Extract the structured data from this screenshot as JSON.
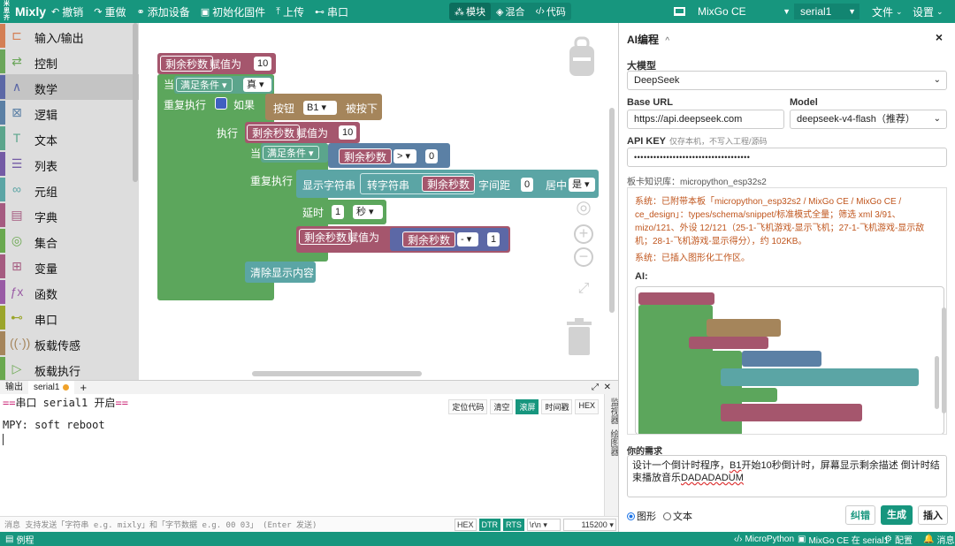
{
  "app": {
    "logo_mark": "米思齐",
    "logo_text": "Mixly"
  },
  "toolbar": {
    "undo": "撤销",
    "redo": "重做",
    "add_device": "添加设备",
    "init_firmware": "初始化固件",
    "upload": "上传",
    "serial": "串口"
  },
  "mode_tabs": [
    {
      "label": "模块",
      "active": true
    },
    {
      "label": "混合",
      "active": false
    },
    {
      "label": "代码",
      "active": false
    }
  ],
  "board": "MixGo CE",
  "port": "serial1",
  "menus": {
    "file": "文件",
    "settings": "设置"
  },
  "categories": [
    {
      "label": "输入/输出",
      "color": "#d47f54",
      "icon": "io-icon",
      "glyph": "⊏"
    },
    {
      "label": "控制",
      "color": "#6ba65a",
      "icon": "control-icon",
      "glyph": "⇄"
    },
    {
      "label": "数学",
      "color": "#5c68a6",
      "icon": "math-icon",
      "glyph": "∧",
      "selected": true
    },
    {
      "label": "逻辑",
      "color": "#5b80a5",
      "icon": "logic-icon",
      "glyph": "⊠"
    },
    {
      "label": "文本",
      "color": "#5ba58c",
      "icon": "text-icon",
      "glyph": "T"
    },
    {
      "label": "列表",
      "color": "#745ba5",
      "icon": "list-icon",
      "glyph": "☰"
    },
    {
      "label": "元组",
      "color": "#5ba5a5",
      "icon": "tuple-icon",
      "glyph": "∞"
    },
    {
      "label": "字典",
      "color": "#a55b80",
      "icon": "dict-icon",
      "glyph": "▤"
    },
    {
      "label": "集合",
      "color": "#6aa84f",
      "icon": "set-icon",
      "glyph": "◎"
    },
    {
      "label": "变量",
      "color": "#a55b80",
      "icon": "variable-icon",
      "glyph": "⊞"
    },
    {
      "label": "函数",
      "color": "#995ba5",
      "icon": "function-icon",
      "glyph": "ƒx"
    },
    {
      "label": "串口",
      "color": "#9ba52b",
      "icon": "serial-icon",
      "glyph": "⊷"
    },
    {
      "label": "板载传感",
      "color": "#a5855b",
      "icon": "sensor-icon",
      "glyph": "((·))"
    },
    {
      "label": "板载执行",
      "color": "#6aa84f",
      "icon": "actuator-icon",
      "glyph": "▷"
    }
  ],
  "blocks": {
    "var_name": "剩余秒数",
    "assign": "赋值为",
    "init_value": "10",
    "while": "当",
    "cond_true": "满足条件",
    "true_val": "真",
    "repeat": "重复执行",
    "if": "如果",
    "button": "按钮",
    "button_id": "B1",
    "pressed": "被按下",
    "do": "执行",
    "gt": ">",
    "zero": "0",
    "show_string": "显示字符串",
    "to_string": "转字符串",
    "spacing": "字间距",
    "spacing_val": "0",
    "center": "居中",
    "center_val": "是",
    "delay": "延时",
    "delay_val": "1",
    "delay_unit": "秒",
    "minus": "-",
    "one": "1",
    "clear_display": "清除显示内容"
  },
  "console": {
    "tab_output": "输出",
    "tab_serial": "serial1",
    "line1_pre": "==",
    "line1_text": "串口 serial1 开启",
    "line1_post": "==",
    "line2": "MPY: soft reboot",
    "tools": [
      {
        "label": "定位代码",
        "on": false
      },
      {
        "label": "清空",
        "on": false
      },
      {
        "label": "滚屏",
        "on": true
      },
      {
        "label": "时间戳",
        "on": false
      },
      {
        "label": "HEX",
        "on": false
      }
    ],
    "side_tabs": [
      "监视器",
      "绘图器"
    ],
    "send_placeholder": "消息 支持发送「字符串 e.g. mixly」和「字节数据 e.g. 00 03」 (Enter 发送)",
    "send_hex": "HEX",
    "send_dtr": "DTR",
    "send_rts": "RTS",
    "line_end": "\\r\\n",
    "baud": "115200"
  },
  "statusbar": {
    "examples": "例程",
    "lang": "MicroPython",
    "board_on": "MixGo CE 在 serial1",
    "config": "配置",
    "messages": "消息"
  },
  "ai": {
    "title": "AI编程",
    "title_caret": "^",
    "model_label": "大模型",
    "model_value": "DeepSeek",
    "base_url_label": "Base URL",
    "base_url": "https://api.deepseek.com",
    "model2_label": "Model",
    "model2_value": "deepseek-v4-flash（推荐）",
    "api_key_label": "API KEY",
    "api_key_hint": "仅存本机，不写入工程/源码",
    "api_key_value": "••••••••••••••••••••••••••••••••••••",
    "kb_line": "板卡知识库：micropython_esp32s2",
    "msg1": "系统：已附带本板「micropython_esp32s2 / MixGo CE / MixGo CE / ce_design」：types/schema/snippet/标准模式全量；筛选 xml 3/91、mizo/121、外设 12/121（25-1-飞机游戏-显示飞机；27-1-飞机游戏-显示敌机；28-1-飞机游戏-显示得分），约 102KB。",
    "msg2": "系统：已插入图形化工作区。",
    "ai_label": "AI:",
    "need_label": "你的需求",
    "need_pre": "设计一个倒计时程序，",
    "need_b1": "B1",
    "need_mid": "开始10秒倒计时，屏幕显示剩余描述 倒计时结束播放音乐",
    "need_ul": "DADADADUM",
    "radio_graphic": "图形",
    "radio_text": "文本",
    "btn_fix": "纠错",
    "btn_gen": "生成",
    "btn_insert": "插入"
  },
  "colors": {
    "brand": "#17967e",
    "var_block": "#a5566d",
    "control_block": "#5ca65c",
    "logic_block": "#5b80a5",
    "text_block": "#5ba58c",
    "actuator_block": "#a5855b",
    "math_block": "#5c68a6"
  }
}
